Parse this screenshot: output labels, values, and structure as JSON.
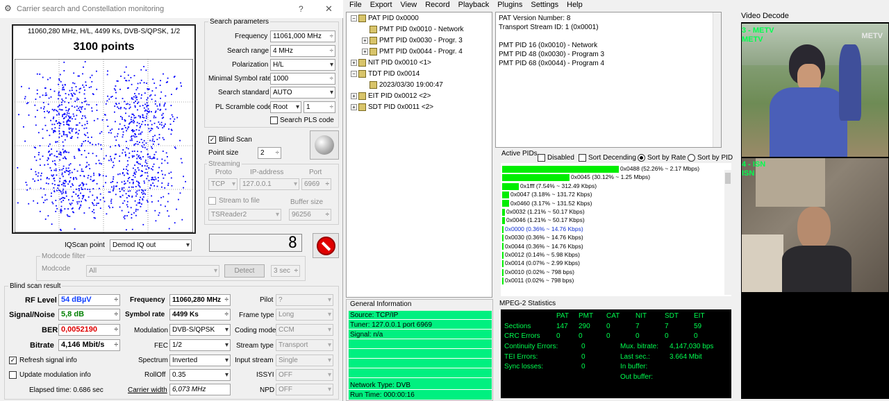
{
  "window": {
    "title": "Carrier search and Constellation monitoring",
    "help_glyph": "?",
    "close_glyph": "✕"
  },
  "constellation": {
    "carrier_info": "11060,280 MHz, H/L, 4499 Ks, DVB-S/QPSK, 1/2",
    "points_label": "3100 points",
    "points": 3100
  },
  "search_params": {
    "title": "Search parameters",
    "frequency_label": "Frequency",
    "frequency_value": "11061,000 MHz",
    "search_range_label": "Search range",
    "search_range_value": "4 MHz",
    "polarization_label": "Polarization",
    "polarization_value": "H/L",
    "min_sr_label": "Minimal Symbol rate",
    "min_sr_value": "1000",
    "search_std_label": "Search standard",
    "search_std_value": "AUTO",
    "pl_scramble_label": "PL Scramble code",
    "pl_scramble_mode": "Root",
    "pl_scramble_value": "1",
    "search_pls_label": "Search PLS code"
  },
  "blind_scan": {
    "label": "Blind Scan",
    "point_size_label": "Point size",
    "point_size_value": "2"
  },
  "streaming": {
    "title": "Streaming",
    "proto_label": "Proto",
    "ip_label": "IP-address",
    "port_label": "Port",
    "proto_value": "TCP",
    "ip_value": "127.0.0.1",
    "port_value": "6969",
    "stream_to_file_label": "Stream to file",
    "buffer_size_label": "Buffer size",
    "file_value": "TSReader2",
    "buffer_value": "96256"
  },
  "iq": {
    "label": "IQScan point",
    "value": "Demod IQ out",
    "digit": "8"
  },
  "modcode": {
    "title": "Modcode filter",
    "label": "Modcode",
    "value": "All",
    "detect_label": "Detect",
    "sec_value": "3 sec"
  },
  "result": {
    "title": "Blind scan result",
    "rf_label": "RF Level",
    "rf_value": "54 dBµV",
    "sn_label": "Signal/Noise",
    "sn_value": "5,8 dB",
    "ber_label": "BER",
    "ber_value": "0,0052190",
    "bitrate_label": "Bitrate",
    "bitrate_value": "4,146 Mbit/s",
    "freq_label": "Frequency",
    "freq_value": "11060,280 MHz",
    "sr_label": "Symbol rate",
    "sr_value": "4499 Ks",
    "mod_label": "Modulation",
    "mod_value": "DVB-S/QPSK",
    "fec_label": "FEC",
    "fec_value": "1/2",
    "spectrum_label": "Spectrum",
    "spectrum_value": "Inverted",
    "rolloff_label": "RollOff",
    "rolloff_value": "0.35",
    "carrier_width_label": "Carrier width",
    "carrier_width_value": "6,073 MHz",
    "pilot_label": "Pilot",
    "pilot_value": "?",
    "frame_label": "Frame type",
    "frame_value": "Long",
    "coding_label": "Coding mode",
    "coding_value": "CCM",
    "stream_label": "Stream type",
    "stream_value": "Transport",
    "input_label": "Input stream",
    "input_value": "Single",
    "issyi_label": "ISSYI",
    "issyi_value": "OFF",
    "npd_label": "NPD",
    "npd_value": "OFF",
    "refresh_label": "Refresh signal info",
    "update_mod_label": "Update modulation info",
    "elapsed_label": "Elapsed time: 0.686 sec"
  },
  "menu": [
    "File",
    "Export",
    "View",
    "Record",
    "Playback",
    "Plugins",
    "Settings",
    "Help"
  ],
  "tree": [
    {
      "label": "PAT PID 0x0000",
      "indent": 0,
      "exp": "−"
    },
    {
      "label": "PMT PID 0x0010 - Network",
      "indent": 1,
      "exp": ""
    },
    {
      "label": "PMT PID 0x0030 - Progr. 3",
      "indent": 1,
      "exp": "+"
    },
    {
      "label": "PMT PID 0x0044 - Progr. 4",
      "indent": 1,
      "exp": "+"
    },
    {
      "label": "NIT PID 0x0010 <1>",
      "indent": 0,
      "exp": "+"
    },
    {
      "label": "TDT PID 0x0014",
      "indent": 0,
      "exp": "−"
    },
    {
      "label": "2023/03/30 19:00:47",
      "indent": 1,
      "exp": ""
    },
    {
      "label": "EIT PID 0x0012 <2>",
      "indent": 0,
      "exp": "+"
    },
    {
      "label": "SDT PID 0x0011 <2>",
      "indent": 0,
      "exp": "+"
    }
  ],
  "pat_info": [
    "PAT Version Number: 8",
    "Transport Stream ID: 1 (0x0001)",
    "",
    "PMT PID 16 (0x0010) - Network",
    "PMT PID 48 (0x0030) - Program 3",
    "PMT PID 68 (0x0044) - Program 4"
  ],
  "active_pids": {
    "title": "Active PIDs",
    "disabled_label": "Disabled",
    "sort_desc_label": "Sort Decending",
    "sort_rate_label": "Sort by Rate",
    "sort_pid_label": "Sort by PID",
    "rows": [
      {
        "text": "0x0488 (52.26% ~ 2.17 Mbps)",
        "pct": 52.26,
        "blue": false
      },
      {
        "text": "0x0045 (30.12% ~ 1.25 Mbps)",
        "pct": 30.12,
        "blue": false
      },
      {
        "text": "0x1fff (7.54% ~ 312.49 Kbps)",
        "pct": 7.54,
        "blue": false
      },
      {
        "text": "0x0047 (3.18% ~ 131.72 Kbps)",
        "pct": 3.18,
        "blue": false
      },
      {
        "text": "0x0460 (3.17% ~ 131.52 Kbps)",
        "pct": 3.17,
        "blue": false
      },
      {
        "text": "0x0032 (1.21% ~ 50.17 Kbps)",
        "pct": 1.21,
        "blue": false
      },
      {
        "text": "0x0046 (1.21% ~ 50.17 Kbps)",
        "pct": 1.21,
        "blue": false
      },
      {
        "text": "0x0000 (0.36% ~ 14.76 Kbps)",
        "pct": 0.36,
        "blue": true
      },
      {
        "text": "0x0030 (0.36% ~ 14.76 Kbps)",
        "pct": 0.36,
        "blue": false
      },
      {
        "text": "0x0044 (0.36% ~ 14.76 Kbps)",
        "pct": 0.36,
        "blue": false
      },
      {
        "text": "0x0012 (0.14% ~ 5.98 Kbps)",
        "pct": 0.14,
        "blue": false
      },
      {
        "text": "0x0014 (0.07% ~ 2.99 Kbps)",
        "pct": 0.07,
        "blue": false
      },
      {
        "text": "0x0010 (0.02% ~ 798 bps)",
        "pct": 0.02,
        "blue": false
      },
      {
        "text": "0x0011 (0.02% ~ 798 bps)",
        "pct": 0.02,
        "blue": false
      }
    ]
  },
  "general_info": {
    "title": "General Information",
    "source": "Source: TCP/IP",
    "tuner": "Tuner: 127.0.0.1 port 6969",
    "signal": "Signal: n/a",
    "network_type": "Network Type: DVB",
    "run_time": "Run Time: 000:00:16"
  },
  "mpeg2": {
    "title": "MPEG-2 Statistics",
    "headers": [
      "PAT",
      "PMT",
      "CAT",
      "NIT",
      "SDT",
      "EIT"
    ],
    "sections_label": "Sections",
    "sections": [
      "147",
      "290",
      "0",
      "7",
      "7",
      "59"
    ],
    "crc_label": "CRC Errors",
    "crc": [
      "0",
      "0",
      "0",
      "0",
      "0",
      "0"
    ],
    "continuity_label": "Continuity Errors:",
    "continuity_value": "0",
    "tei_label": "TEI Errors:",
    "tei_value": "0",
    "sync_label": "Sync losses:",
    "sync_value": "0",
    "mux_label": "Mux. bitrate:",
    "mux_value": "4,147,030 bps",
    "last_label": "Last sec.:",
    "last_value": "3.664 Mbit",
    "inbuf_label": "In buffer:",
    "outbuf_label": "Out buffer:"
  },
  "video": {
    "title": "Video Decode",
    "ch1_num": "3 - METV",
    "ch1_name": "METV",
    "ch1_logo": "METV",
    "ch2_num": "4 - ISN",
    "ch2_name": "ISN"
  },
  "colors": {
    "accent_green": "#00ee00",
    "info_bg": "#00f080",
    "stats_bg": "#000000",
    "constellation_dot": "#0000ff",
    "ber_red": "#e00000"
  }
}
